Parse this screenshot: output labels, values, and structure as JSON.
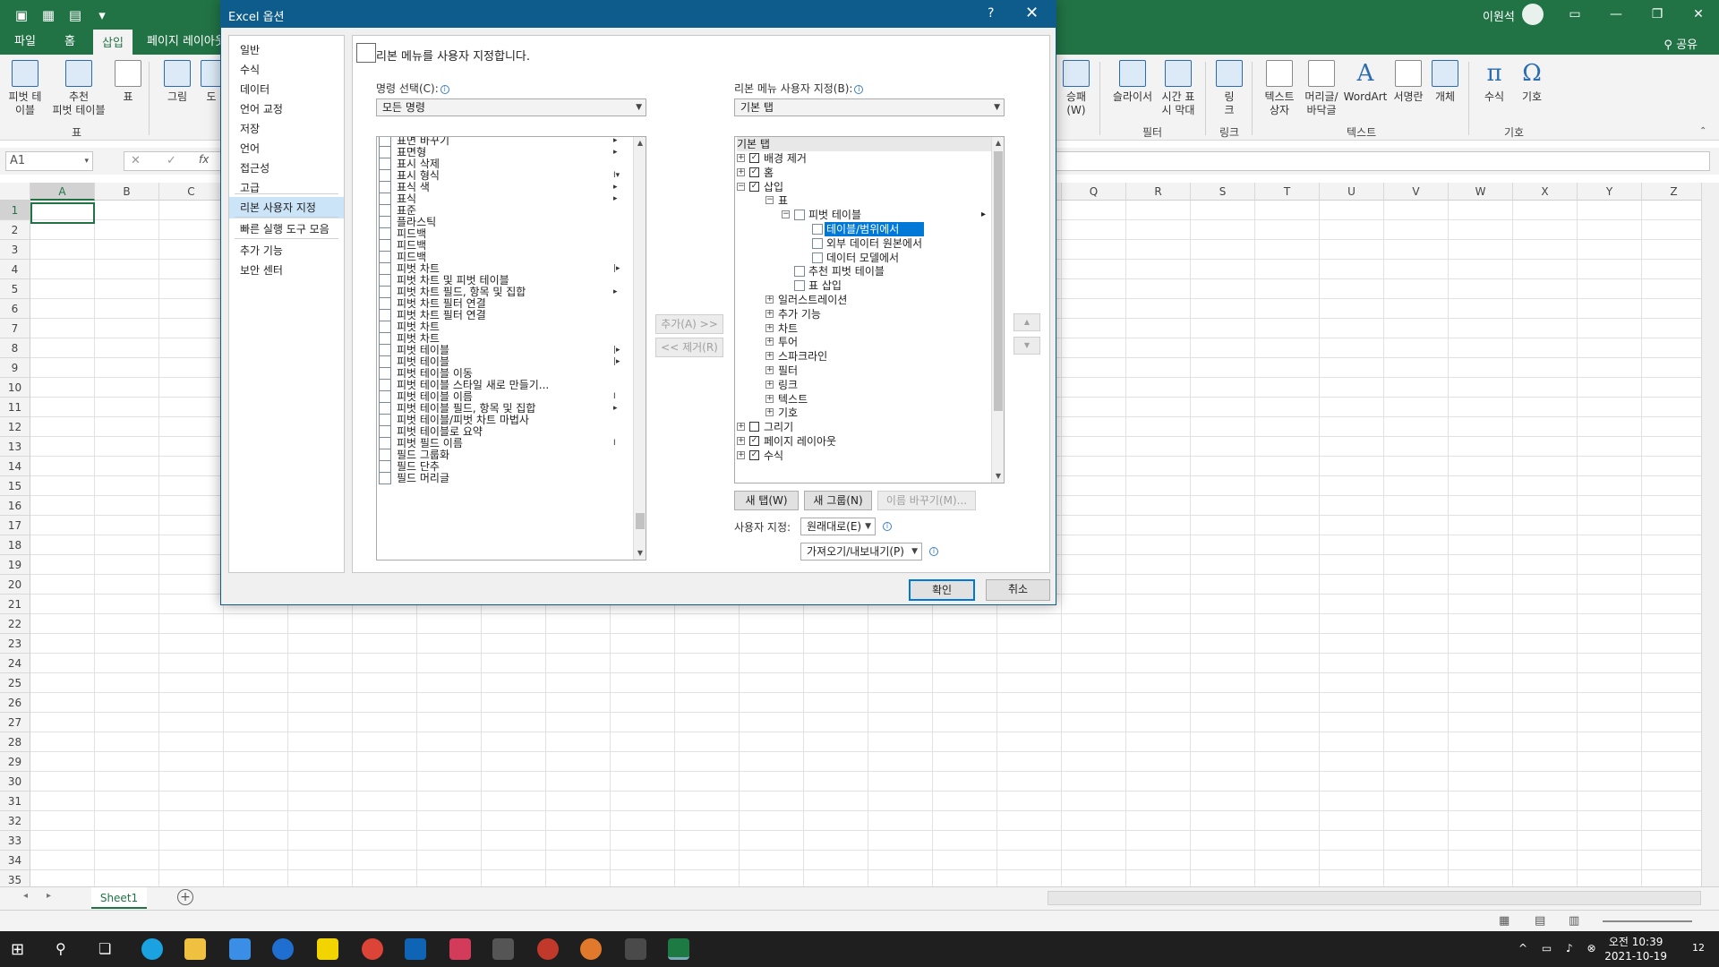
{
  "app": {
    "user_name": "이원석"
  },
  "ribbon_tabs": [
    "파일",
    "홈",
    "삽입",
    "페이지 레이아웃"
  ],
  "share_label": "공유",
  "ribbon": {
    "left_buttons": [
      {
        "label": "피벗 테\n이블",
        "icon": "pivottable-icon"
      },
      {
        "label": "추천\n피벗 테이블",
        "icon": "recommended-pivot-icon"
      },
      {
        "label": "표",
        "icon": "table-icon"
      },
      {
        "label": "그림",
        "icon": "picture-icon"
      },
      {
        "label": "도",
        "icon": "shapes-icon"
      }
    ],
    "left_group": "표",
    "right_buttons": [
      {
        "label": "승패\n(W)",
        "icon": "sparkline-icon"
      },
      {
        "label": "슬라이서",
        "icon": "slicer-icon"
      },
      {
        "label": "시간 표\n시 막대",
        "icon": "timeline-icon"
      },
      {
        "label": "링\n크",
        "icon": "link-icon"
      },
      {
        "label": "텍스트\n상자",
        "icon": "textbox-icon"
      },
      {
        "label": "머리글/\n바닥글",
        "icon": "header-footer-icon"
      },
      {
        "label": "WordArt",
        "icon": "wordart-icon"
      },
      {
        "label": "서명란",
        "icon": "signature-icon"
      },
      {
        "label": "개체",
        "icon": "object-icon"
      },
      {
        "label": "수식",
        "icon": "equation-icon",
        "glyph": "π"
      },
      {
        "label": "기호",
        "icon": "symbol-icon",
        "glyph": "Ω"
      }
    ],
    "right_groups": [
      "필터",
      "링크",
      "텍스트",
      "기호"
    ]
  },
  "formula_bar": {
    "name_box": "A1",
    "fx": "fx"
  },
  "columns": [
    "A",
    "B",
    "C",
    "D",
    "E",
    "F",
    "G",
    "H",
    "I",
    "J",
    "K",
    "L",
    "M",
    "N",
    "O",
    "P",
    "Q",
    "R",
    "S",
    "T",
    "U",
    "V",
    "W",
    "X",
    "Y",
    "Z"
  ],
  "rows": [
    "1",
    "2",
    "3",
    "4",
    "5",
    "6",
    "7",
    "8",
    "9",
    "10",
    "11",
    "12",
    "13",
    "14",
    "15",
    "16",
    "17",
    "18",
    "19",
    "20",
    "21",
    "22",
    "23",
    "24",
    "25",
    "26",
    "27",
    "28",
    "29",
    "30",
    "31",
    "32",
    "33",
    "34",
    "35"
  ],
  "sheet_tab": "Sheet1",
  "taskbar": {
    "time": "오전 10:39",
    "date": "2021-10-19",
    "notifications": "12"
  },
  "dialog": {
    "title": "Excel 옵션",
    "help": "?",
    "close": "✕",
    "categories": [
      "일반",
      "수식",
      "데이터",
      "언어 교정",
      "저장",
      "언어",
      "접근성",
      "고급",
      "리본 사용자 지정",
      "빠른 실행 도구 모음",
      "추가 기능",
      "보안 센터"
    ],
    "selected_category": "리본 사용자 지정",
    "header": "리본 메뉴를 사용자 지정합니다.",
    "commands_label": "명령 선택(C):",
    "commands_value": "모든 명령",
    "customize_label": "리본 메뉴 사용자 지정(B):",
    "customize_value": "기본 탭",
    "commands": [
      {
        "label": "표면 바꾸기",
        "arrow": "▸"
      },
      {
        "label": "표면형",
        "arrow": "▸"
      },
      {
        "label": "표시 삭제",
        "arrow": ""
      },
      {
        "label": "표시 형식",
        "arrow": "I▾"
      },
      {
        "label": "표식 색",
        "arrow": "▸"
      },
      {
        "label": "표식",
        "arrow": "▸"
      },
      {
        "label": "표준",
        "arrow": ""
      },
      {
        "label": "플라스틱",
        "arrow": ""
      },
      {
        "label": "피드백",
        "arrow": ""
      },
      {
        "label": "피드백",
        "arrow": ""
      },
      {
        "label": "피드백",
        "arrow": ""
      },
      {
        "label": "피벗 차트",
        "arrow": "|▸"
      },
      {
        "label": "피벗 차트 및 피벗 테이블",
        "arrow": ""
      },
      {
        "label": "피벗 차트 필드, 항목 및 집합",
        "arrow": "▸"
      },
      {
        "label": "피벗 차트 필터 연결",
        "arrow": ""
      },
      {
        "label": "피벗 차트 필터 연결",
        "arrow": ""
      },
      {
        "label": "피벗 차트",
        "arrow": ""
      },
      {
        "label": "피벗 차트",
        "arrow": ""
      },
      {
        "label": "피벗 테이블",
        "arrow": "|▸"
      },
      {
        "label": "피벗 테이블",
        "arrow": "|▸"
      },
      {
        "label": "피벗 테이블 이동",
        "arrow": ""
      },
      {
        "label": "피벗 테이블 스타일 새로 만들기...",
        "arrow": ""
      },
      {
        "label": "피벗 테이블 이름",
        "arrow": "I"
      },
      {
        "label": "피벗 테이블 필드, 항목 및 집합",
        "arrow": "▸"
      },
      {
        "label": "피벗 테이블/피벗 차트 마법사",
        "arrow": ""
      },
      {
        "label": "피벗 테이블로 요약",
        "arrow": ""
      },
      {
        "label": "피벗 필드 이름",
        "arrow": "I"
      },
      {
        "label": "필드 그룹화",
        "arrow": ""
      },
      {
        "label": "필드 단추",
        "arrow": ""
      },
      {
        "label": "필드 머리글",
        "arrow": ""
      }
    ],
    "add_btn": "추가(A) >>",
    "remove_btn": "<< 제거(R)",
    "tree_header": "기본 탭",
    "tree": [
      {
        "label": "배경 제거",
        "level": 0,
        "exp": "+",
        "cb": "✓"
      },
      {
        "label": "홈",
        "level": 0,
        "exp": "+",
        "cb": "✓"
      },
      {
        "label": "삽입",
        "level": 0,
        "exp": "−",
        "cb": "✓"
      },
      {
        "label": "표",
        "level": 1,
        "exp": "−",
        "cb": ""
      },
      {
        "label": "피벗 테이블",
        "level": 2,
        "exp": "−",
        "cb": "",
        "arrow": "▸"
      },
      {
        "label": "테이블/범위에서",
        "level": 3,
        "exp": "",
        "cb": "",
        "selected": true
      },
      {
        "label": "외부 데이터 원본에서",
        "level": 3,
        "exp": "",
        "cb": ""
      },
      {
        "label": "데이터 모델에서",
        "level": 3,
        "exp": "",
        "cb": ""
      },
      {
        "label": "추천 피벗 테이블",
        "level": 2,
        "exp": "",
        "cb": ""
      },
      {
        "label": "표 삽입",
        "level": 2,
        "exp": "",
        "cb": ""
      },
      {
        "label": "일러스트레이션",
        "level": 1,
        "exp": "+",
        "cb": ""
      },
      {
        "label": "추가 기능",
        "level": 1,
        "exp": "+",
        "cb": ""
      },
      {
        "label": "차트",
        "level": 1,
        "exp": "+",
        "cb": ""
      },
      {
        "label": "투어",
        "level": 1,
        "exp": "+",
        "cb": ""
      },
      {
        "label": "스파크라인",
        "level": 1,
        "exp": "+",
        "cb": ""
      },
      {
        "label": "필터",
        "level": 1,
        "exp": "+",
        "cb": ""
      },
      {
        "label": "링크",
        "level": 1,
        "exp": "+",
        "cb": ""
      },
      {
        "label": "텍스트",
        "level": 1,
        "exp": "+",
        "cb": ""
      },
      {
        "label": "기호",
        "level": 1,
        "exp": "+",
        "cb": ""
      },
      {
        "label": "그리기",
        "level": 0,
        "exp": "+",
        "cb": " "
      },
      {
        "label": "페이지 레이아웃",
        "level": 0,
        "exp": "+",
        "cb": "✓"
      },
      {
        "label": "수식",
        "level": 0,
        "exp": "+",
        "cb": "✓"
      }
    ],
    "move_up": "▲",
    "move_down": "▼",
    "new_tab": "새 탭(W)",
    "new_group": "새 그룹(N)",
    "rename": "이름 바꾸기(M)...",
    "customize_reset_label": "사용자 지정:",
    "reset_value": "원래대로(E)",
    "import_export": "가져오기/내보내기(P)",
    "ok": "확인",
    "cancel": "취소"
  }
}
